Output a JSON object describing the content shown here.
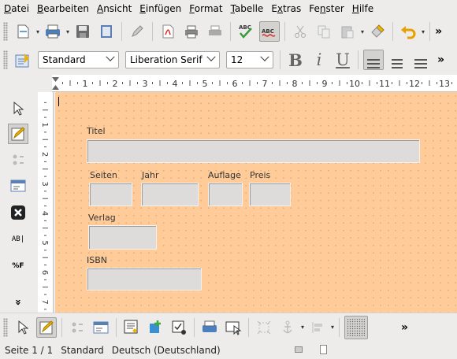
{
  "menu": [
    {
      "label": "Datei",
      "u": "D",
      "rest": "atei"
    },
    {
      "label": "Bearbeiten",
      "u": "B",
      "rest": "earbeiten"
    },
    {
      "label": "Ansicht",
      "u": "A",
      "rest": "nsicht"
    },
    {
      "label": "Einfügen",
      "u": "E",
      "rest": "infügen"
    },
    {
      "label": "Format",
      "u": "F",
      "rest": "ormat"
    },
    {
      "label": "Tabelle",
      "u": "T",
      "rest": "abelle"
    },
    {
      "label": "Extras",
      "u": "x",
      "rest": "tras"
    },
    {
      "label": "Fenster",
      "u": "n",
      "rest": "ster"
    },
    {
      "label": "Hilfe",
      "u": "H",
      "rest": "ilfe"
    }
  ],
  "formatting": {
    "style": "Standard",
    "font": "Liberation Serif",
    "size": "12",
    "bold": "B",
    "italic": "i",
    "underline": "U"
  },
  "ruler": {
    "ticks": [
      "1",
      "2",
      "3",
      "4",
      "5",
      "6",
      "7",
      "8",
      "9",
      "10",
      "11",
      "12",
      "13"
    ],
    "vticks": [
      "1",
      "2",
      "3",
      "4",
      "5",
      "6",
      "7"
    ]
  },
  "form": {
    "titel": "Titel",
    "seiten": "Seiten",
    "jahr": "Jahr",
    "auflage": "Auflage",
    "preis": "Preis",
    "verlag": "Verlag",
    "isbn": "ISBN"
  },
  "leftbar": {
    "more": "»",
    "textbox": "AB|",
    "formatted": "%F"
  },
  "bottombar": {
    "more": "»"
  },
  "status": {
    "page": "Seite 1 / 1",
    "style": "Standard",
    "language": "Deutsch (Deutschland)"
  },
  "colors": {
    "page_bg": "#ffcc99",
    "field_bg": "#dddcdb",
    "ui_bg": "#edeceb"
  }
}
